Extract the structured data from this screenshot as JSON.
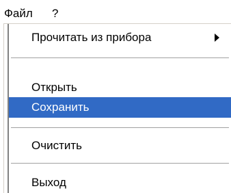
{
  "menubar": {
    "items": [
      {
        "label": "Файл"
      },
      {
        "label": "?"
      }
    ]
  },
  "menu": {
    "items": [
      {
        "label": "Прочитать из прибора",
        "has_submenu": true,
        "submenu_icon": "triangle-right-icon"
      },
      {
        "label": "Открыть"
      },
      {
        "label": "Сохранить",
        "selected": true
      },
      {
        "label": "Очистить"
      },
      {
        "label": "Выход"
      }
    ]
  },
  "colors": {
    "selection_background": "#316ac5",
    "selection_text": "#ffffff"
  }
}
